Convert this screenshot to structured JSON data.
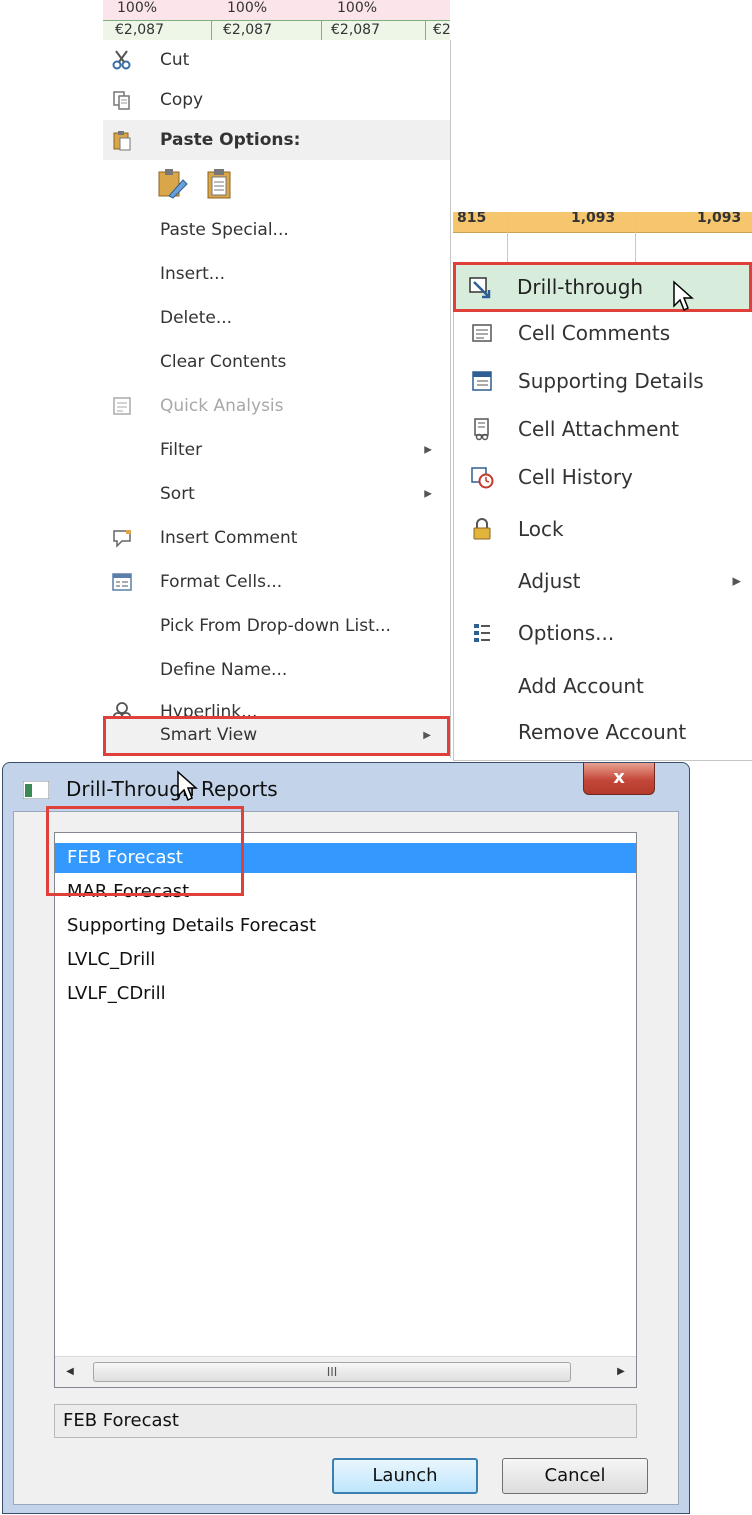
{
  "sheet": {
    "top_row": [
      "100%",
      "100%",
      "100%"
    ],
    "second_row": [
      "€2,087",
      "€2,087",
      "€2,087",
      "€2"
    ],
    "right_row": [
      "815",
      "1,093",
      "1,093"
    ]
  },
  "context_menu": {
    "cut": "Cut",
    "copy": "Copy",
    "paste_options": "Paste Options:",
    "paste_special": "Paste Special...",
    "insert": "Insert...",
    "delete": "Delete...",
    "clear_contents": "Clear Contents",
    "quick_analysis": "Quick Analysis",
    "filter": "Filter",
    "sort": "Sort",
    "insert_comment": "Insert Comment",
    "format_cells": "Format Cells...",
    "pick_from_list": "Pick From Drop-down List...",
    "define_name": "Define Name...",
    "hyperlink": "Hyperlink...",
    "smart_view": "Smart View"
  },
  "smart_view_submenu": {
    "drill_through": "Drill-through",
    "cell_comments": "Cell Comments",
    "supporting_details": "Supporting Details",
    "cell_attachment": "Cell Attachment",
    "cell_history": "Cell History",
    "lock": "Lock",
    "adjust": "Adjust",
    "options": "Options...",
    "add_account": "Add Account",
    "remove_account": "Remove Account"
  },
  "dialog": {
    "title": "Drill-Through Reports",
    "close_label": "x",
    "reports": [
      "FEB Forecast",
      "MAR Forecast",
      "Supporting Details Forecast",
      "LVLC_Drill",
      "LVLF_CDrill"
    ],
    "selected_report": "FEB Forecast",
    "scroll_thumb_grip": "III",
    "launch_label": "Launch",
    "cancel_label": "Cancel"
  },
  "colors": {
    "highlight_red": "#e0403a",
    "selection_blue": "#3399ff",
    "drill_highlight": "#d7ecdb"
  }
}
